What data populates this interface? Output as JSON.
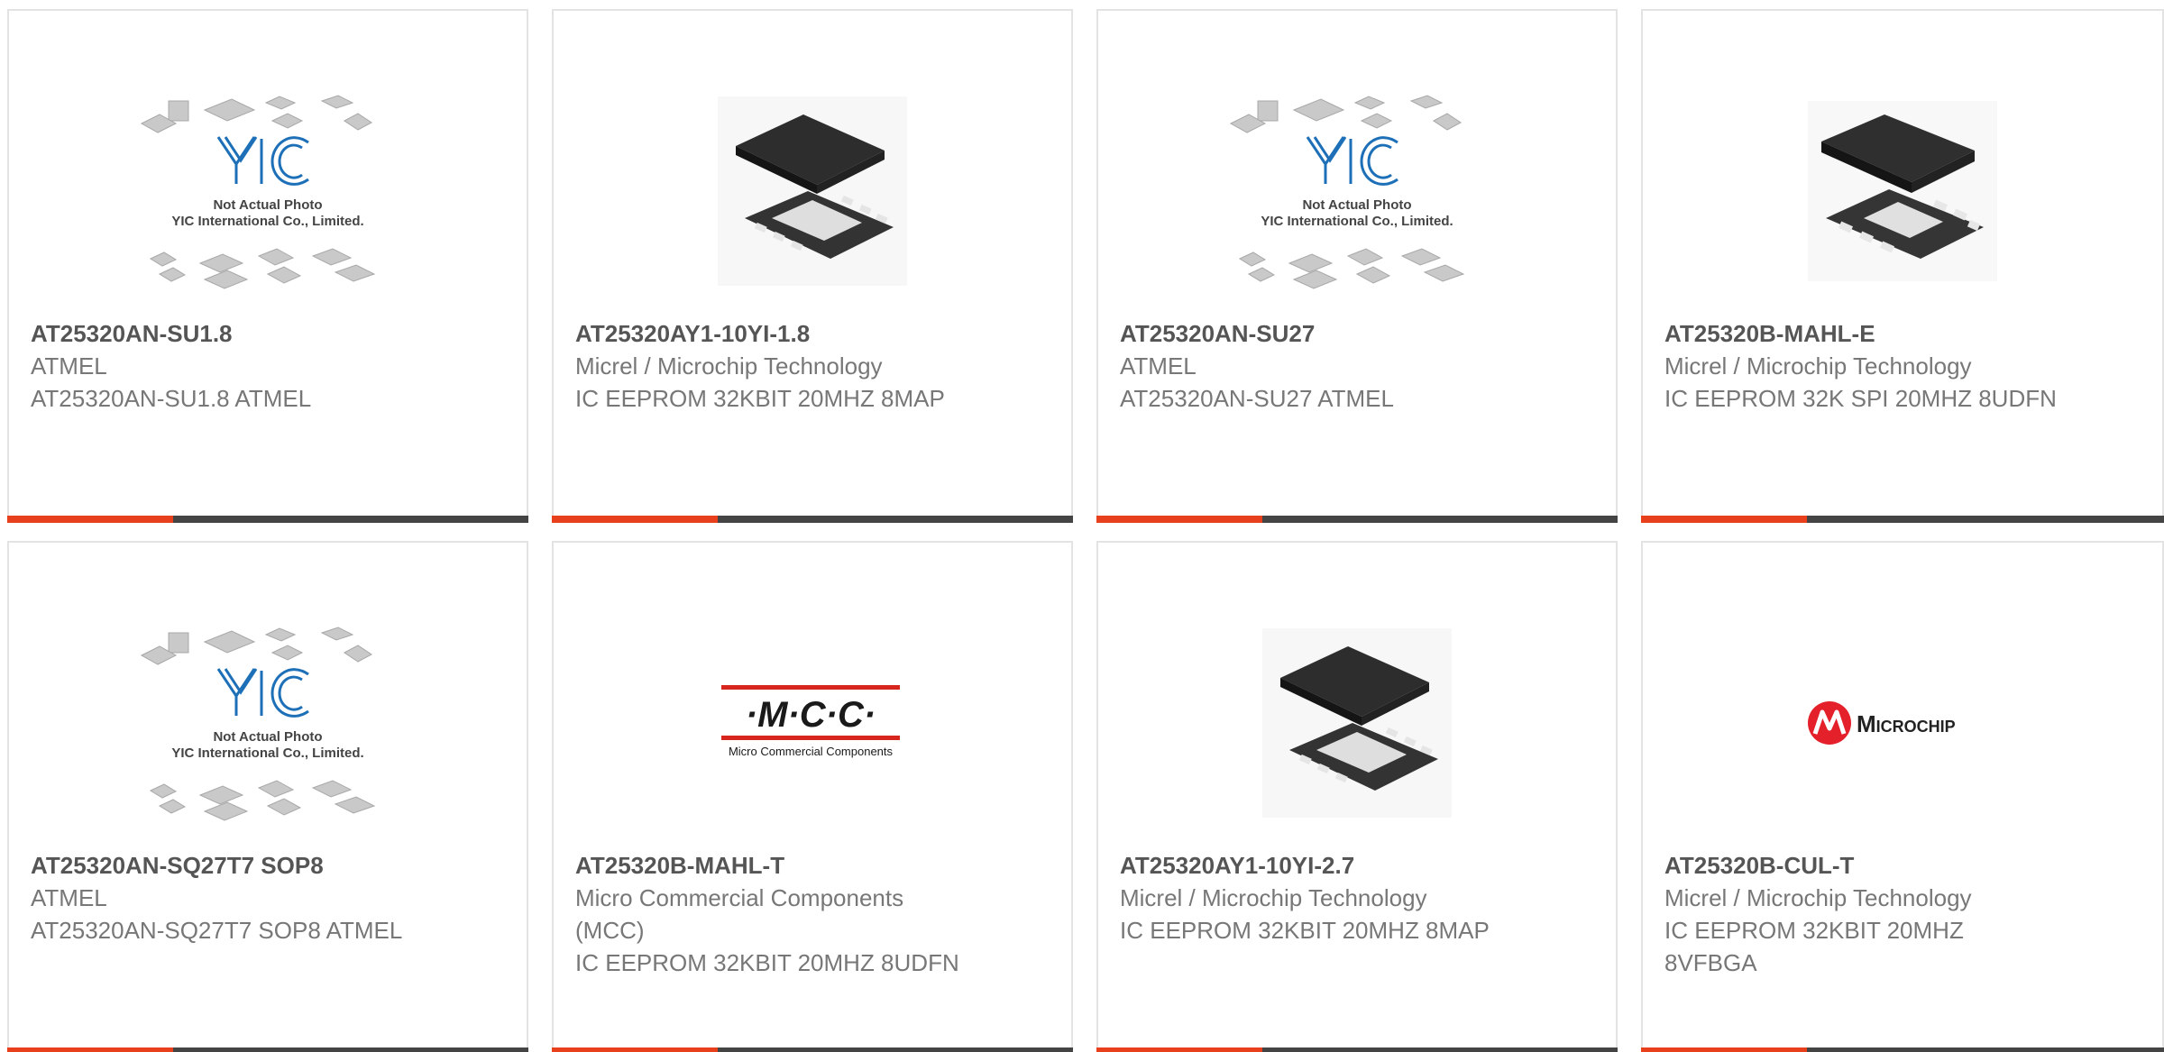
{
  "brand_colors": {
    "accent": "#e8401c",
    "bar": "#444444",
    "yic_blue": "#1d70b7",
    "mcc_red": "#d7261e",
    "microchip_red": "#e4202b"
  },
  "products": [
    {
      "part_number": "AT25320AN-SU1.8",
      "manufacturer": "ATMEL",
      "description": "AT25320AN-SU1.8 ATMEL",
      "image": "yic-placeholder-photo",
      "placeholder_line1": "Not Actual Photo",
      "placeholder_line2": "YIC International Co., Limited."
    },
    {
      "part_number": "AT25320AY1-10YI-1.8",
      "manufacturer": "Micrel / Microchip Technology",
      "description": "IC EEPROM 32KBIT 20MHZ 8MAP",
      "image": "chip-map-package-photo"
    },
    {
      "part_number": "AT25320AN-SU27",
      "manufacturer": "ATMEL",
      "description": "AT25320AN-SU27 ATMEL",
      "image": "yic-placeholder-photo",
      "placeholder_line1": "Not Actual Photo",
      "placeholder_line2": "YIC International Co., Limited."
    },
    {
      "part_number": "AT25320B-MAHL-E",
      "manufacturer": "Micrel / Microchip Technology",
      "description": "IC EEPROM 32K SPI 20MHZ 8UDFN",
      "image": "chip-udfn-package-photo"
    },
    {
      "part_number": "AT25320AN-SQ27T7 SOP8",
      "manufacturer": "ATMEL",
      "description": "AT25320AN-SQ27T7 SOP8 ATMEL",
      "image": "yic-placeholder-photo",
      "placeholder_line1": "Not Actual Photo",
      "placeholder_line2": "YIC International Co., Limited."
    },
    {
      "part_number": "AT25320B-MAHL-T",
      "manufacturer": "Micro Commercial Components (MCC)",
      "description": "IC EEPROM 32KBIT 20MHZ 8UDFN",
      "image": "mcc-logo",
      "logo_text": "·M·C·C·",
      "logo_subtext": "Micro Commercial Components"
    },
    {
      "part_number": "AT25320AY1-10YI-2.7",
      "manufacturer": "Micrel / Microchip Technology",
      "description": "IC EEPROM 32KBIT 20MHZ 8MAP",
      "image": "chip-map-package-photo"
    },
    {
      "part_number": "AT25320B-CUL-T",
      "manufacturer": "Micrel / Microchip Technology",
      "description": "IC EEPROM 32KBIT 20MHZ 8VFBGA",
      "image": "microchip-logo",
      "logo_text": "Microchip"
    }
  ]
}
